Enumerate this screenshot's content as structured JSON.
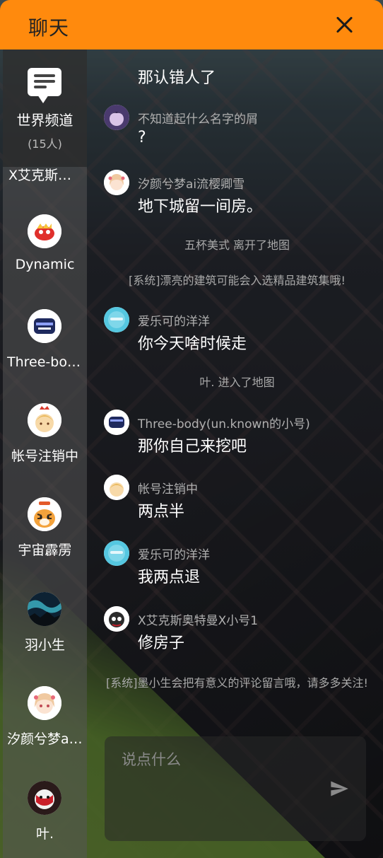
{
  "header": {
    "title": "聊天"
  },
  "world_channel": {
    "name": "世界频道",
    "count": "(15人)"
  },
  "sidebar": {
    "partial_user": "X艾克斯奥特曼X小号1",
    "users": [
      {
        "name": "Dynamic",
        "avatar": "red-creature-avatar"
      },
      {
        "name": "Three-body(un.known的小号)",
        "avatar": "navy-badge-avatar"
      },
      {
        "name": "帐号注销中",
        "avatar": "blonde-character-avatar"
      },
      {
        "name": "宇宙霹雳",
        "avatar": "tiger-avatar"
      },
      {
        "name": "羽小生",
        "avatar": "aurora-landscape-avatar"
      },
      {
        "name": "汐颜兮梦ai流樱卿雪",
        "avatar": "anime-girl-avatar"
      },
      {
        "name": "叶.",
        "avatar": "red-mask-avatar"
      }
    ]
  },
  "messages": [
    {
      "text": "那认错人了"
    },
    {
      "sender": "不知道起什么名字的屑",
      "text": "?"
    },
    {
      "sender": "汐颜兮梦ai流樱卿雪",
      "text": "地下城留一间房。"
    },
    {
      "system": "五杯美式 离开了地图"
    },
    {
      "system": "[系统]漂亮的建筑可能会入选精品建筑集哦!"
    },
    {
      "sender": "爱乐可的洋洋",
      "text": "你今天啥时候走"
    },
    {
      "system": "叶. 进入了地图"
    },
    {
      "sender": "Three-body(un.known的小号)",
      "text": "那你自己来挖吧"
    },
    {
      "sender": "帐号注销中",
      "text": "两点半"
    },
    {
      "sender": "爱乐可的洋洋",
      "text": "我两点退"
    },
    {
      "sender": "X艾克斯奥特曼X小号1",
      "text": "修房子"
    },
    {
      "system": "[系统]墨小生会把有意义的评论留言哦，请多多关注!"
    }
  ],
  "input": {
    "placeholder": "说点什么"
  }
}
